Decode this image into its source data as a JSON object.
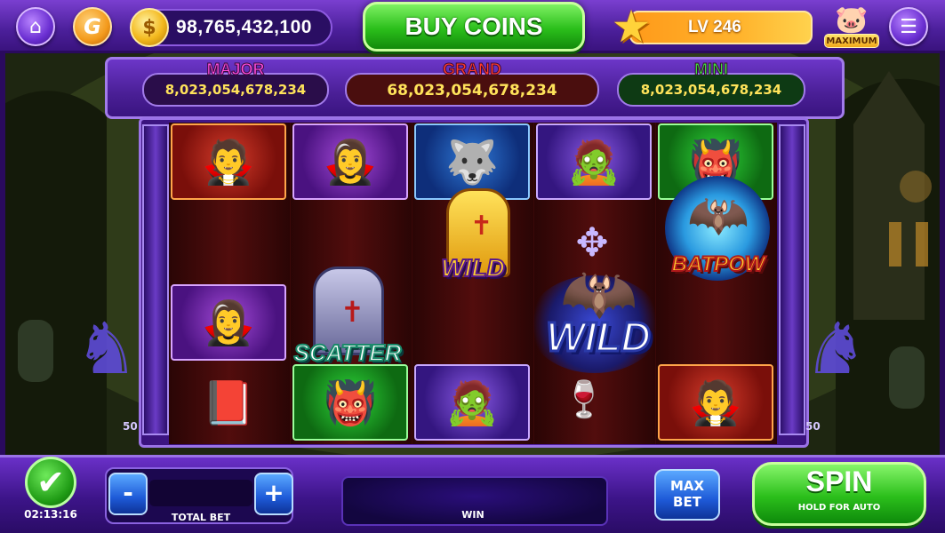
{
  "header": {
    "home_icon": "home-icon",
    "profile_icon": "g-logo-icon",
    "profile_letter": "G",
    "coin_symbol": "$",
    "coins": "98,765,432,100",
    "buy_coins_label": "BUY COINS",
    "level_label": "LV 246",
    "piggy_badge": "MAXIMUM",
    "menu_icon": "hamburger-menu-icon"
  },
  "jackpots": [
    {
      "label": "MAJOR",
      "value": "8,023,054,678,234",
      "color": "#ff4de0"
    },
    {
      "label": "GRAND",
      "value": "68,023,054,678,234",
      "color": "#ff3a2a"
    },
    {
      "label": "MINI",
      "value": "8,023,054,678,234",
      "color": "#3ddf3a"
    }
  ],
  "reels": {
    "wild_small": "WILD",
    "wild_big": "WILD",
    "scatter": "SCATTER",
    "batpow": "BATPOW",
    "left_line_count": "50",
    "right_line_count": "50"
  },
  "controls": {
    "minus": "-",
    "plus": "+",
    "total_bet_label": "TOTAL BET",
    "total_bet_value": "",
    "win_label": "WIN",
    "win_value": "",
    "max_bet_line1": "MAX",
    "max_bet_line2": "BET",
    "spin_label": "SPIN",
    "spin_sub": "HOLD FOR AUTO",
    "timer": "02:13:16",
    "check": "✔"
  },
  "colors": {
    "frame_purple": "#4b1f9a",
    "buy_green": "#2bbf1b",
    "level_orange": "#ffb32c",
    "jackpot_gold": "#ffe35a"
  }
}
